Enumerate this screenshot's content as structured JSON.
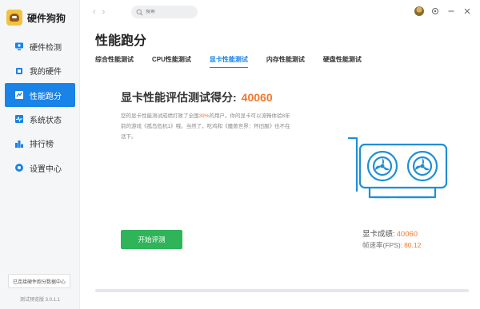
{
  "app": {
    "name": "硬件狗狗"
  },
  "sidebar": {
    "items": [
      {
        "label": "硬件检测",
        "icon": "monitor-icon",
        "active": false
      },
      {
        "label": "我的硬件",
        "icon": "chip-icon",
        "active": false
      },
      {
        "label": "性能跑分",
        "icon": "benchmark-icon",
        "active": true
      },
      {
        "label": "系统状态",
        "icon": "pulse-icon",
        "active": false
      },
      {
        "label": "排行榜",
        "icon": "ranking-icon",
        "active": false
      },
      {
        "label": "设置中心",
        "icon": "gear-icon",
        "active": false
      }
    ],
    "dataset_button": "已连接硬件跑分数据中心",
    "version": "测试预览版 3.0.1.1"
  },
  "topbar": {
    "back": "‹",
    "forward": "›",
    "search_placeholder": "搜索",
    "icons": [
      "avatar-icon",
      "settings-icon",
      "minimize-icon",
      "close-icon"
    ]
  },
  "main": {
    "title": "性能跑分",
    "tabs": [
      {
        "label": "综合性能测试",
        "active": false
      },
      {
        "label": "CPU性能测试",
        "active": false
      },
      {
        "label": "显卡性能测试",
        "active": true
      },
      {
        "label": "内存性能测试",
        "active": false
      },
      {
        "label": "硬盘性能测试",
        "active": false
      }
    ],
    "score_label": "显卡性能评估测试得分:",
    "score_value": "40060",
    "description": {
      "part1": "您的显卡性能测试成绩打败了全国",
      "percent": "39%",
      "part2": "的用户。你的显卡可以流畅体验8年前的游戏《孤岛危机1》哦。当然了，吃鸡和《魔兽世界：怀旧服》也不在话下。"
    },
    "start_button": "开始评测",
    "results": {
      "score_label": "显卡成绩:",
      "score_value": "40060",
      "fps_label": "帧速率(FPS):",
      "fps_value": "80.12"
    },
    "progress": 0
  },
  "colors": {
    "accent": "#1a83e8",
    "orange": "#f0782d",
    "green": "#2fb45a",
    "illustration": "#1f8fd6"
  }
}
